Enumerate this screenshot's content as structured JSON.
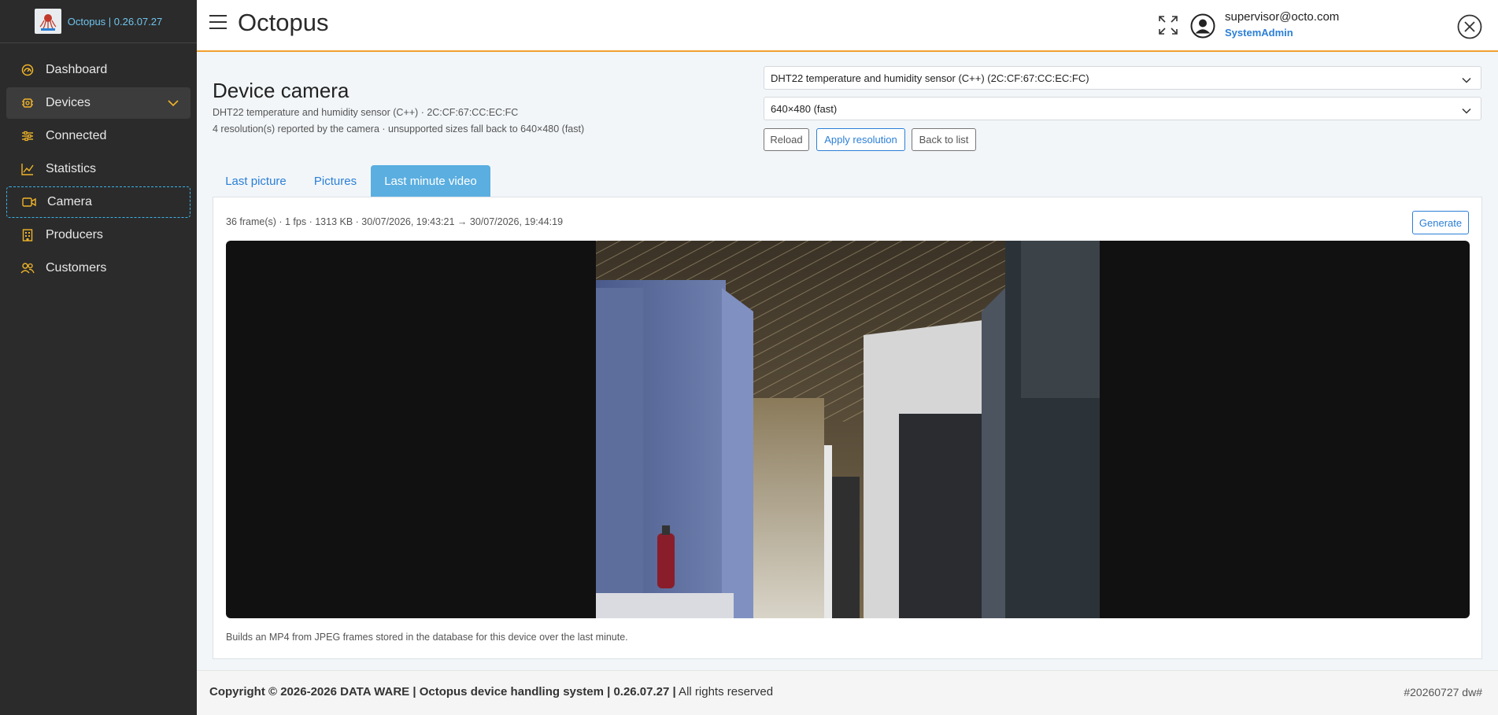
{
  "brand": {
    "name": "Octopus | 0.26.07.27"
  },
  "sidebar": {
    "items": [
      {
        "label": "Dashboard",
        "icon": "dashboard-icon"
      },
      {
        "label": "Devices",
        "icon": "devices-icon"
      },
      {
        "label": "Connected",
        "icon": "connected-icon"
      },
      {
        "label": "Statistics",
        "icon": "statistics-icon"
      },
      {
        "label": "Camera",
        "icon": "camera-icon"
      },
      {
        "label": "Producers",
        "icon": "producers-icon"
      },
      {
        "label": "Customers",
        "icon": "customers-icon"
      }
    ],
    "accent_color": "#f0b429",
    "selected_border_color": "#3bb3e8"
  },
  "header": {
    "title": "Octopus",
    "user_email": "supervisor@octo.com",
    "user_role": "SystemAdmin",
    "accent_color": "#f0a030"
  },
  "page": {
    "title": "Device camera",
    "subtitle": "DHT22 temperature and humidity sensor (C++) · 2C:CF:67:CC:EC:FC",
    "resolution_note": "4 resolution(s) reported by the camera · unsupported sizes fall back to 640×480 (fast)"
  },
  "controls": {
    "device_select_value": "DHT22 temperature and humidity sensor (C++) (2C:CF:67:CC:EC:FC)",
    "resolution_select_value": "640×480 (fast)",
    "reload_label": "Reload",
    "apply_label": "Apply resolution",
    "back_label": "Back to list"
  },
  "tabs": [
    {
      "label": "Last picture"
    },
    {
      "label": "Pictures"
    },
    {
      "label": "Last minute video"
    }
  ],
  "video_panel": {
    "meta": "36 frame(s) · 1 fps · 1313 KB · 30/07/2026, 19:43:21 → 30/07/2026, 19:44:19",
    "generate_label": "Generate",
    "note": "Builds an MP4 from JPEG frames stored in the database for this device over the last minute."
  },
  "footer": {
    "copyright_bold": "Copyright © 2026-2026 DATA WARE | Octopus device handling system | 0.26.07.27 |",
    "copyright_rest": " All rights reserved",
    "build": "#20260727 dw#"
  }
}
